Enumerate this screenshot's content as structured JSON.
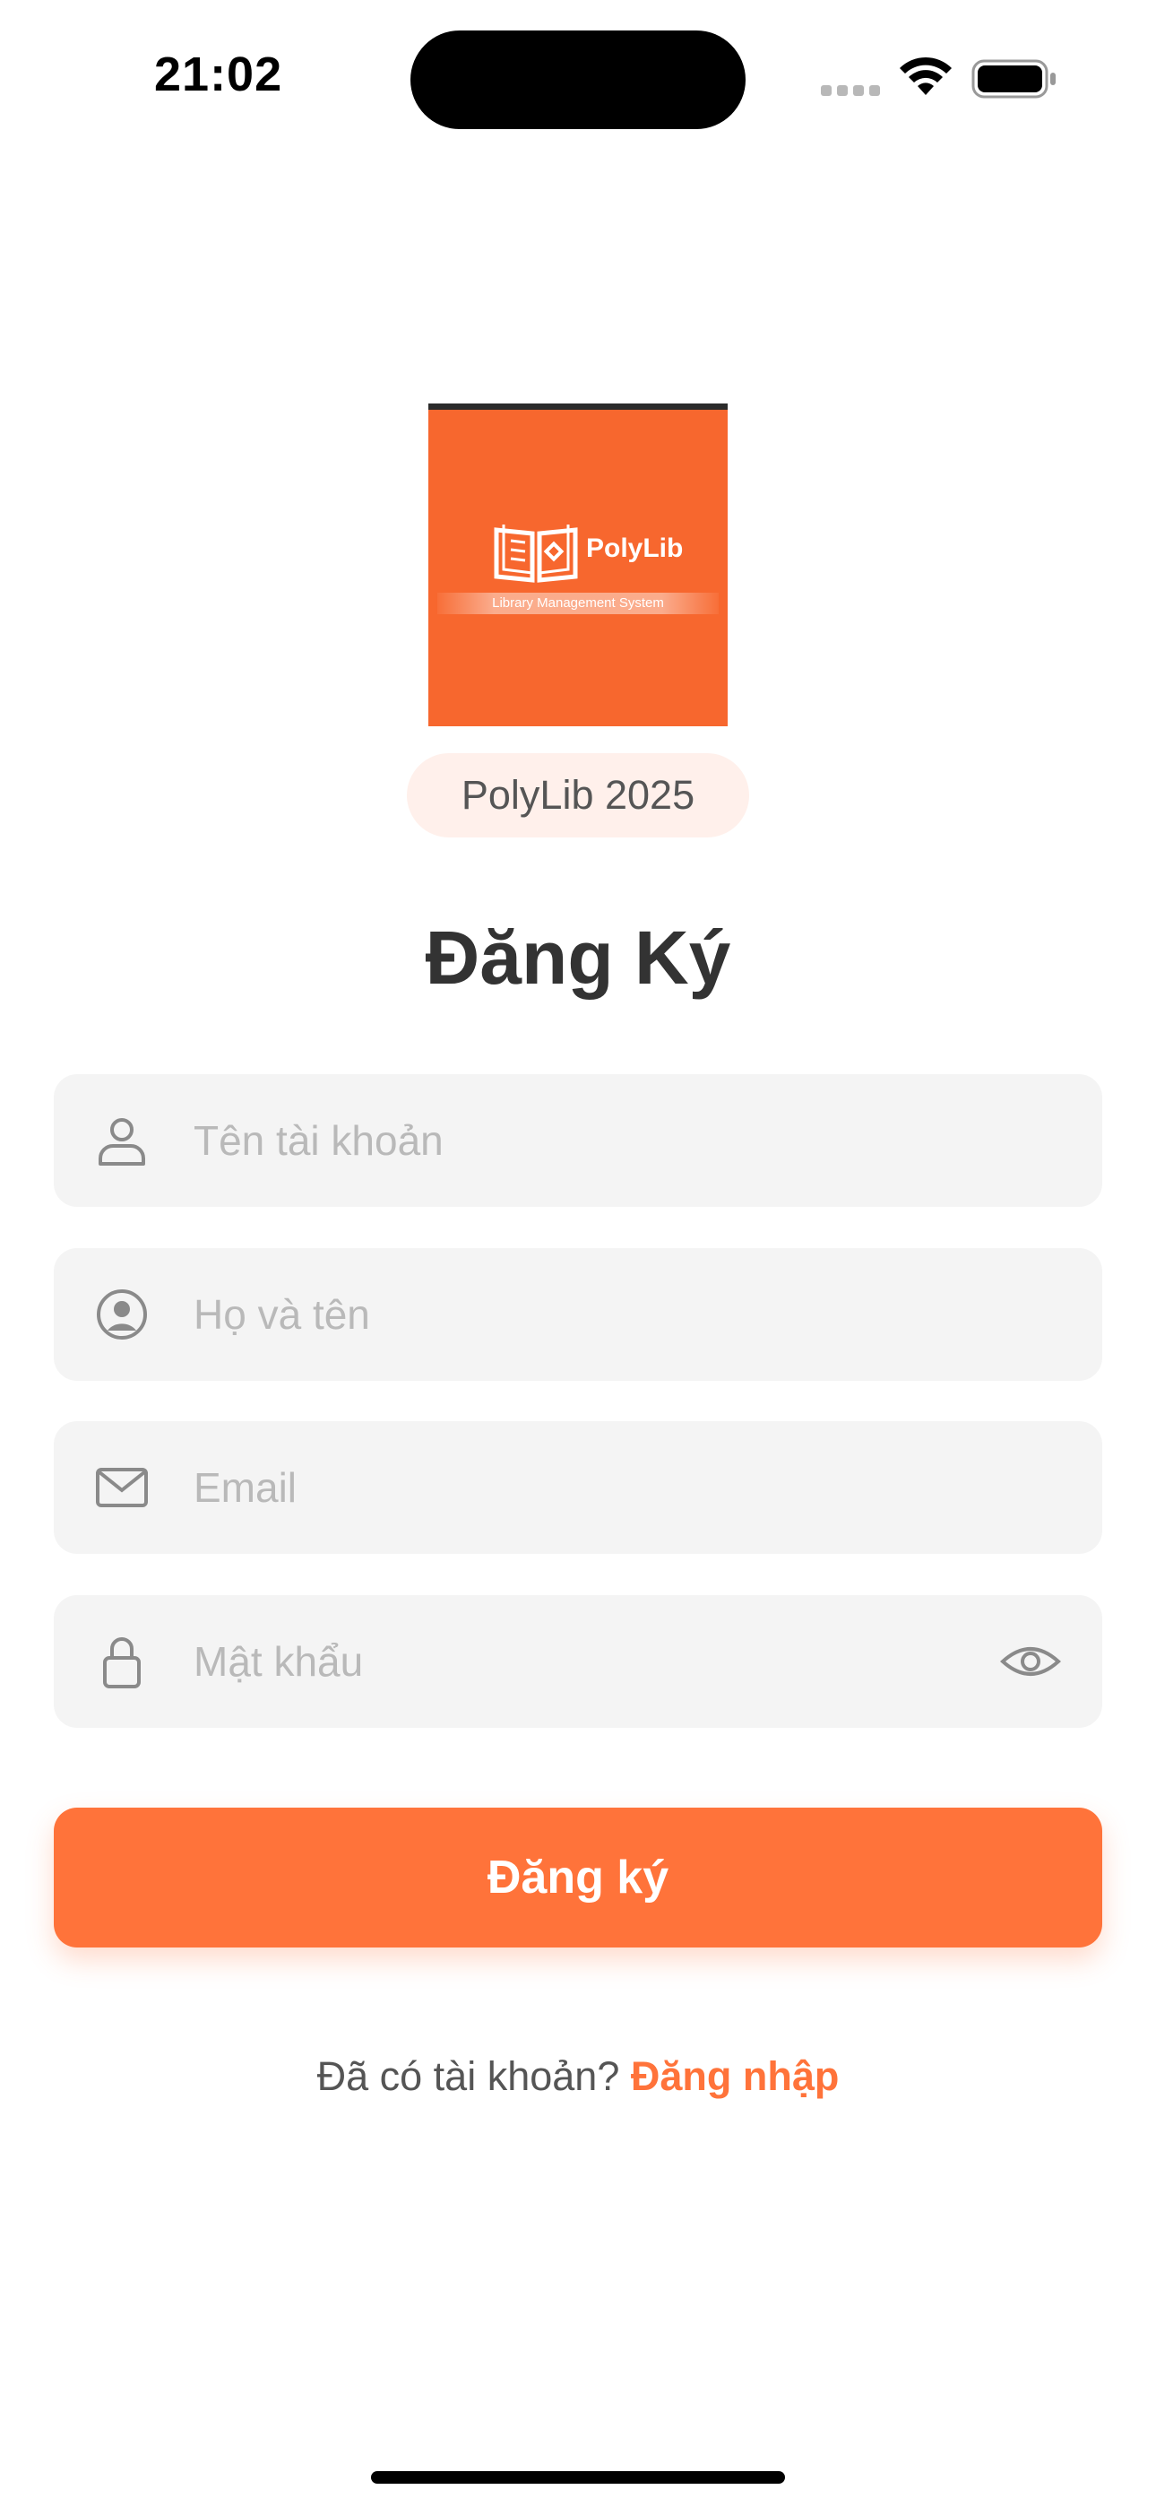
{
  "status_bar": {
    "time": "21:02"
  },
  "logo": {
    "brand": "PolyLib",
    "tagline": "Library Management System"
  },
  "badge": "PolyLib 2025",
  "title": "Đăng Ký",
  "fields": {
    "username": {
      "placeholder": "Tên tài khoản",
      "icon": "user-outline-icon"
    },
    "fullname": {
      "placeholder": "Họ và tên",
      "icon": "user-circle-icon"
    },
    "email": {
      "placeholder": "Email",
      "icon": "envelope-icon"
    },
    "password": {
      "placeholder": "Mật khẩu",
      "icon": "lock-icon",
      "toggle_icon": "eye-icon"
    }
  },
  "submit_label": "Đăng ký",
  "footer": {
    "prompt": "Đã có tài khoản?",
    "link": "Đăng nhập"
  },
  "colors": {
    "accent": "#ff733a",
    "logo_bg": "#f7672e",
    "field_bg": "#f4f4f4"
  }
}
